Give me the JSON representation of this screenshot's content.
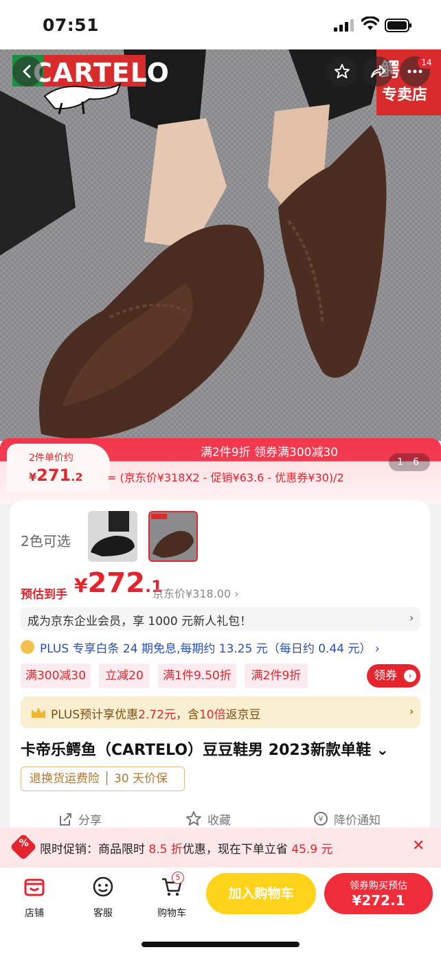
{
  "status_bar": {
    "time": "07:51"
  },
  "hero": {
    "brand_text": "CARTELO",
    "store_tag_line1": "鳄",
    "store_tag_line2": "专卖店",
    "message_count": "14"
  },
  "promo": {
    "unit_label": "2件单价约",
    "unit_price_symbol": "¥",
    "unit_price_int": "271",
    "unit_price_dec": ".2",
    "strip_text": "满2件9折 领券满300减30",
    "formula": "= (京东价¥318X2 - 促销¥63.6 - 优惠券¥30)/2",
    "pager_current": "1",
    "pager_total": "6"
  },
  "product": {
    "colors_label": "2色可选",
    "est_label": "预估到手",
    "est_symbol": "¥",
    "est_int": "272",
    "est_dec": ".1",
    "jd_price": "京东价¥318.00 ›",
    "member_text": "成为京东企业会员，享 1000 元新人礼包！",
    "member_arrow": "›",
    "plus_text": "PLUS 专享白条 24 期免息,每期约 13.25 元（每日约 0.44 元） ›",
    "tags": [
      "满300减30",
      "立减20",
      "满1件9.50折",
      "满2件9折"
    ],
    "coupon_btn": "领券",
    "plus_bar_prefix": "PLUS预计享优惠",
    "plus_bar_amount": "2.72元",
    "plus_bar_mid": "，含",
    "plus_bar_times": "10倍",
    "plus_bar_suffix": "返京豆",
    "plus_bar_arrow": "›",
    "title": "卡帝乐鳄鱼（CARTELO）豆豆鞋男 2023新款单鞋 ⌄",
    "service": "退换货运费险 │ 30 天价保",
    "actions": {
      "share": "分享",
      "favorite": "收藏",
      "price_alert": "降价通知"
    }
  },
  "flash": {
    "icon": "%",
    "prefix": "限时促销：商品限时 ",
    "discount": "8.5 折",
    "mid": "优惠，现在下单立省 ",
    "save": "45.9 元",
    "close": "✕"
  },
  "bottom_bar": {
    "store": "店铺",
    "service": "客服",
    "cart": "购物车",
    "cart_count": "5",
    "add_to_cart": "加入购物车",
    "buy_line1": "领券购买预估",
    "buy_line2": "¥272.1"
  },
  "colors": {
    "accent": "#e4252d",
    "gold": "#ffd31a",
    "plus_blue": "#2a50b5"
  }
}
